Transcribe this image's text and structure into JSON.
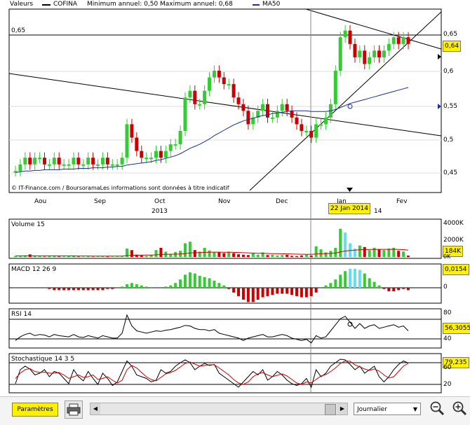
{
  "header": {
    "valeurs_label": "Valeurs",
    "symbol": "COFINA",
    "minmax": "Minimum annuel: 0,50 Maximum annuel: 0,68",
    "ma_label": "MA50"
  },
  "colors": {
    "up": "#33cc33",
    "down": "#cc0000",
    "ma": "#1a2e9e",
    "highlight": "#fff200",
    "accent_cyan": "#66ddee"
  },
  "price_panel": {
    "level_label": "0,65",
    "current_value": "0,64",
    "y_ticks": [
      "0,65",
      "0,6",
      "0,55",
      "0,5",
      "0,45"
    ],
    "copyright": "© IT-Finance.com / BoursoramaLes informations sont données à titre indicatif"
  },
  "x_axis": {
    "months": [
      "Aou",
      "Sep",
      "Oct",
      "Nov",
      "Dec",
      "Jan",
      "Fev"
    ],
    "year_label": "2013",
    "year_label_2": "14",
    "cursor_date": "22 Jan 2014"
  },
  "volume_panel": {
    "title": "Volume 15",
    "y_ticks": [
      "4000K",
      "2000K",
      "0K"
    ],
    "current_value": "184K"
  },
  "macd_panel": {
    "title": "MACD 12 26 9",
    "y_ticks": [
      "0"
    ],
    "current_value": "0,0154"
  },
  "rsi_panel": {
    "title": "RSI 14",
    "y_ticks": [
      "80",
      "40"
    ],
    "current_value": "56,3055"
  },
  "stoch_panel": {
    "title": "Stochastique 14 3 5",
    "y_ticks": [
      "80",
      "60",
      "20"
    ],
    "current_value": "79,235"
  },
  "toolbar": {
    "params_label": "Paramètres",
    "period_value": "Journalier"
  },
  "chart_data": [
    {
      "type": "candlestick",
      "title": "COFINA",
      "x": [
        "Aou",
        "Sep",
        "Oct",
        "Nov",
        "Dec",
        "Jan",
        "Fev"
      ],
      "ylim": [
        0.42,
        0.69
      ],
      "close": [
        0.45,
        0.46,
        0.47,
        0.46,
        0.47,
        0.47,
        0.46,
        0.46,
        0.47,
        0.46,
        0.46,
        0.46,
        0.47,
        0.46,
        0.46,
        0.47,
        0.46,
        0.46,
        0.47,
        0.46,
        0.46,
        0.46,
        0.47,
        0.52,
        0.5,
        0.48,
        0.47,
        0.47,
        0.47,
        0.48,
        0.47,
        0.48,
        0.49,
        0.49,
        0.51,
        0.56,
        0.57,
        0.55,
        0.55,
        0.57,
        0.59,
        0.6,
        0.59,
        0.58,
        0.58,
        0.56,
        0.55,
        0.54,
        0.52,
        0.53,
        0.54,
        0.55,
        0.53,
        0.53,
        0.54,
        0.55,
        0.54,
        0.53,
        0.52,
        0.51,
        0.51,
        0.5,
        0.52,
        0.52,
        0.53,
        0.55,
        0.6,
        0.65,
        0.66,
        0.64,
        0.62,
        0.63,
        0.61,
        0.62,
        0.63,
        0.62,
        0.63,
        0.64,
        0.65,
        0.64,
        0.65,
        0.64
      ],
      "ma50": [
        0.448,
        0.449,
        0.45,
        0.45,
        0.451,
        0.451,
        0.452,
        0.452,
        0.452,
        0.452,
        0.453,
        0.453,
        0.453,
        0.454,
        0.454,
        0.454,
        0.455,
        0.455,
        0.455,
        0.456,
        0.456,
        0.457,
        0.457,
        0.459,
        0.46,
        0.461,
        0.462,
        0.463,
        0.464,
        0.466,
        0.467,
        0.469,
        0.471,
        0.473,
        0.476,
        0.48,
        0.484,
        0.487,
        0.49,
        0.494,
        0.498,
        0.503,
        0.507,
        0.511,
        0.515,
        0.519,
        0.522,
        0.525,
        0.527,
        0.529,
        0.531,
        0.533,
        0.534,
        0.536,
        0.537,
        0.538,
        0.539,
        0.54,
        0.54,
        0.54,
        0.54,
        0.539,
        0.539,
        0.539,
        0.539,
        0.54,
        0.542,
        0.545,
        0.548,
        0.551,
        0.553,
        0.555,
        0.557,
        0.559,
        0.561,
        0.563,
        0.565,
        0.567,
        0.569,
        0.571,
        0.573,
        0.575
      ]
    },
    {
      "type": "bar",
      "title": "Volume 15",
      "ylim": [
        0,
        4500
      ],
      "values": [
        120,
        80,
        200,
        340,
        150,
        90,
        60,
        180,
        110,
        70,
        60,
        90,
        150,
        60,
        50,
        80,
        40,
        70,
        120,
        60,
        50,
        60,
        80,
        1100,
        900,
        300,
        200,
        150,
        250,
        900,
        1200,
        700,
        400,
        650,
        800,
        1800,
        2000,
        900,
        700,
        1200,
        850,
        650,
        600,
        500,
        700,
        500,
        350,
        300,
        250,
        500,
        300,
        600,
        250,
        300,
        200,
        250,
        280,
        150,
        120,
        200,
        300,
        180,
        1400,
        1000,
        600,
        800,
        1200,
        3700,
        3200,
        1800,
        1100,
        1500,
        1300,
        900,
        1200,
        1000,
        900,
        1100,
        1200,
        800,
        700,
        180
      ],
      "avg": [
        140,
        140,
        145,
        150,
        150,
        148,
        145,
        145,
        143,
        140,
        138,
        136,
        135,
        132,
        128,
        125,
        122,
        120,
        118,
        115,
        112,
        110,
        108,
        170,
        220,
        235,
        240,
        245,
        250,
        280,
        320,
        345,
        355,
        370,
        390,
        450,
        520,
        550,
        570,
        600,
        620,
        630,
        635,
        625,
        620,
        610,
        590,
        560,
        530,
        510,
        490,
        480,
        460,
        445,
        430,
        415,
        400,
        385,
        370,
        360,
        350,
        340,
        390,
        420,
        440,
        470,
        510,
        650,
        780,
        850,
        900,
        940,
        970,
        980,
        990,
        1000,
        1000,
        1005,
        1010,
        990,
        960,
        900
      ]
    },
    {
      "type": "bar",
      "title": "MACD 12 26 9",
      "values": [
        0.0,
        0.0,
        0.0,
        0.0,
        0.0,
        0.0,
        0.0,
        -0.001,
        -0.002,
        -0.002,
        -0.002,
        -0.002,
        -0.002,
        -0.002,
        -0.002,
        -0.002,
        -0.002,
        -0.002,
        -0.002,
        -0.001,
        -0.001,
        0.0,
        0.001,
        0.003,
        0.004,
        0.003,
        0.002,
        0.001,
        0.0,
        0.0,
        0.0,
        0.001,
        0.002,
        0.004,
        0.007,
        0.011,
        0.013,
        0.012,
        0.01,
        0.009,
        0.008,
        0.006,
        0.004,
        0.002,
        -0.001,
        -0.004,
        -0.007,
        -0.01,
        -0.012,
        -0.012,
        -0.01,
        -0.008,
        -0.007,
        -0.006,
        -0.005,
        -0.005,
        -0.005,
        -0.006,
        -0.007,
        -0.008,
        -0.008,
        -0.007,
        -0.004,
        0.0,
        0.002,
        0.004,
        0.007,
        0.011,
        0.014,
        0.016,
        0.016,
        0.015,
        0.012,
        0.008,
        0.005,
        0.002,
        -0.001,
        -0.003,
        -0.003,
        -0.002,
        -0.001,
        -0.002
      ]
    },
    {
      "type": "line",
      "title": "RSI 14",
      "ylim": [
        30,
        90
      ],
      "values": [
        40,
        46,
        50,
        52,
        48,
        50,
        49,
        46,
        50,
        48,
        47,
        46,
        50,
        46,
        45,
        48,
        46,
        44,
        48,
        46,
        44,
        44,
        52,
        82,
        64,
        56,
        54,
        52,
        54,
        56,
        55,
        57,
        58,
        60,
        62,
        65,
        64,
        60,
        58,
        58,
        56,
        58,
        52,
        50,
        48,
        46,
        44,
        40,
        44,
        46,
        48,
        50,
        46,
        46,
        48,
        50,
        48,
        44,
        42,
        40,
        42,
        36,
        48,
        44,
        46,
        56,
        66,
        76,
        80,
        70,
        60,
        68,
        60,
        64,
        66,
        60,
        62,
        64,
        66,
        62,
        64,
        56
      ]
    },
    {
      "type": "line",
      "title": "Stochastique 14 3 5",
      "ylim": [
        0,
        100
      ],
      "series": [
        {
          "values": [
            20,
            60,
            70,
            62,
            45,
            50,
            60,
            40,
            55,
            50,
            35,
            20,
            60,
            40,
            28,
            55,
            35,
            18,
            50,
            35,
            15,
            25,
            55,
            85,
            70,
            45,
            40,
            35,
            25,
            30,
            60,
            50,
            55,
            70,
            80,
            88,
            80,
            60,
            70,
            78,
            72,
            75,
            50,
            40,
            30,
            20,
            10,
            25,
            40,
            55,
            45,
            60,
            30,
            40,
            55,
            45,
            30,
            20,
            15,
            20,
            35,
            10,
            60,
            40,
            50,
            70,
            80,
            90,
            88,
            75,
            60,
            70,
            50,
            60,
            70,
            40,
            25,
            40,
            60,
            75,
            85,
            79
          ]
        },
        {
          "values": [
            35,
            50,
            60,
            63,
            55,
            52,
            53,
            50,
            50,
            52,
            45,
            35,
            40,
            45,
            38,
            40,
            45,
            32,
            35,
            40,
            30,
            22,
            30,
            60,
            72,
            65,
            52,
            40,
            32,
            28,
            38,
            48,
            52,
            58,
            68,
            78,
            82,
            76,
            70,
            72,
            74,
            74,
            65,
            55,
            45,
            32,
            22,
            18,
            25,
            40,
            48,
            52,
            45,
            40,
            44,
            48,
            42,
            32,
            22,
            18,
            25,
            22,
            32,
            42,
            46,
            55,
            65,
            78,
            85,
            84,
            74,
            68,
            62,
            58,
            62,
            56,
            45,
            36,
            40,
            55,
            70,
            78
          ]
        }
      ]
    }
  ]
}
